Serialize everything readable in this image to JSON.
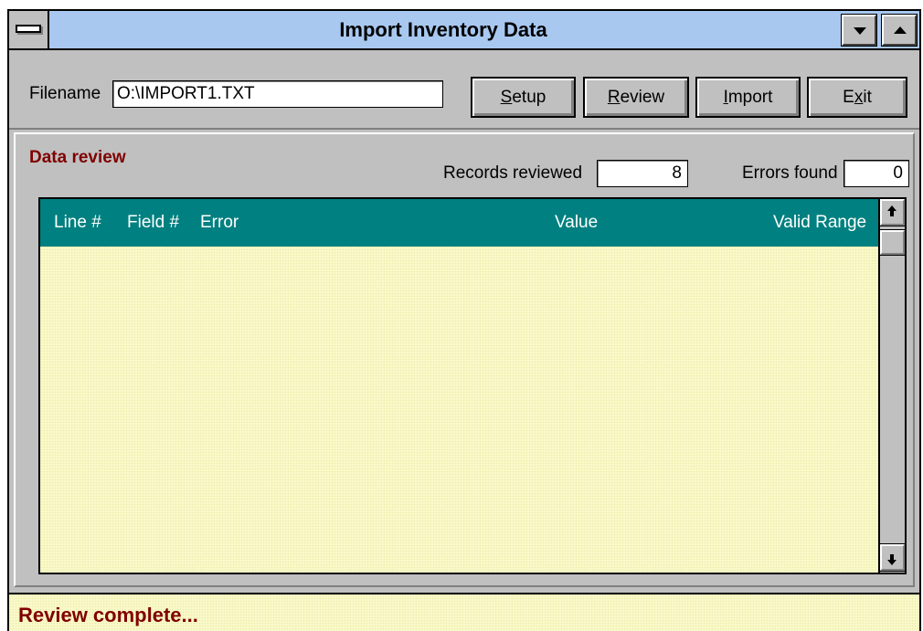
{
  "window": {
    "title": "Import Inventory Data"
  },
  "toolbar": {
    "filename_label": "Filename",
    "filename_value": "O:\\IMPORT1.TXT",
    "buttons": {
      "setup": {
        "mnemonic": "S",
        "rest": "etup"
      },
      "review": {
        "mnemonic": "R",
        "rest": "eview"
      },
      "import": {
        "mnemonic": "I",
        "rest": "mport"
      },
      "exit": {
        "pre": "E",
        "mnemonic": "x",
        "rest": "it"
      }
    }
  },
  "review": {
    "title": "Data review",
    "records_label": "Records reviewed",
    "records_value": "8",
    "errors_label": "Errors found",
    "errors_value": "0",
    "columns": [
      "Line #",
      "Field #",
      "Error",
      "Value",
      "Valid Range"
    ],
    "rows": []
  },
  "status": {
    "text": "Review complete..."
  },
  "colors": {
    "titlebar": "#a8c8f0",
    "header": "#008080",
    "accent_text": "#800000",
    "grid_bg": "#f8f8c8"
  }
}
